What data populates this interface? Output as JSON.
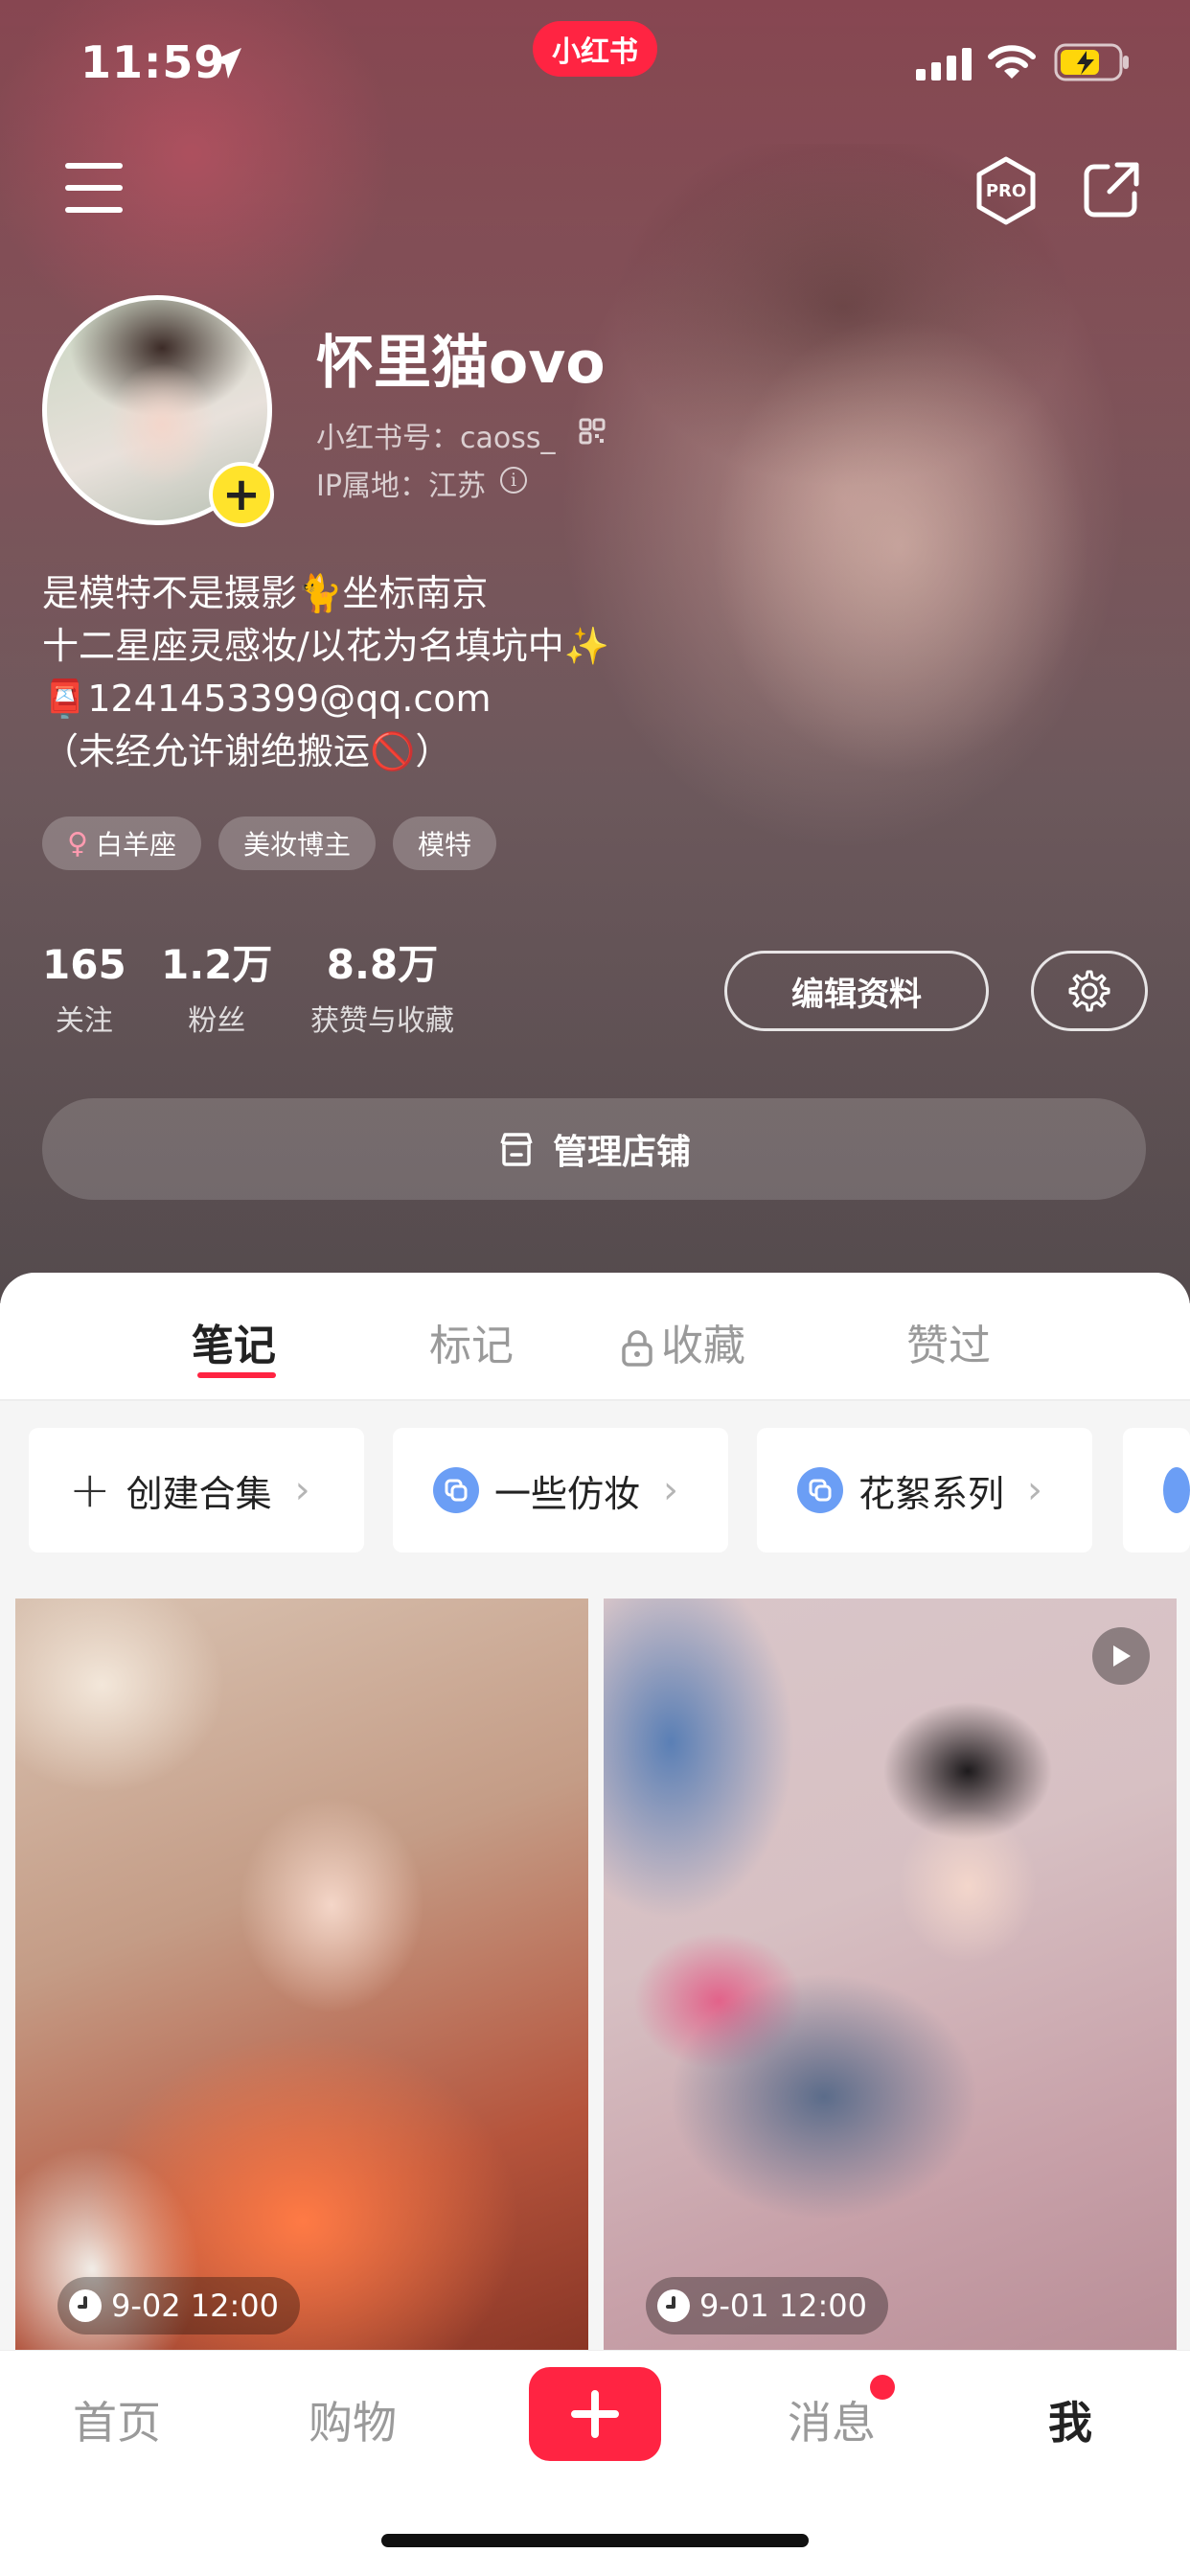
{
  "status_bar": {
    "time": "11:59",
    "app_badge": "小红书"
  },
  "profile": {
    "nickname": "怀里猫ovo",
    "rednote_id": "小红书号：caoss_",
    "ip_location": "IP属地：江苏",
    "bio": [
      "是模特不是摄影🐈坐标南京",
      "十二星座灵感妆/以花为名填坑中✨",
      "📮1241453399@qq.com",
      "（未经允许谢绝搬运🚫）"
    ],
    "tags": [
      "白羊座",
      "美妆博主",
      "模特"
    ]
  },
  "stats": [
    {
      "value": "165",
      "label": "关注"
    },
    {
      "value": "1.2万",
      "label": "粉丝"
    },
    {
      "value": "8.8万",
      "label": "获赞与收藏"
    }
  ],
  "actions": {
    "edit_profile": "编辑资料",
    "manage_store": "管理店铺"
  },
  "tabs": [
    "笔记",
    "标记",
    "收藏",
    "赞过"
  ],
  "collections": [
    "创建合集",
    "一些仿妆",
    "花絮系列"
  ],
  "notes": [
    {
      "time": "9-02 12:00"
    },
    {
      "time": "9-01 12:00"
    }
  ],
  "bottom_nav": [
    "首页",
    "购物",
    "消息",
    "我"
  ],
  "colors": {
    "accent": "#ff2442",
    "tag_yellow": "#ffe32b",
    "collection_icon": "#6b9ef5"
  },
  "icons": {
    "location_arrow": "location-arrow-icon",
    "menu": "menu-icon",
    "pro": "pro-icon",
    "share": "share-icon",
    "qr": "qr-code-icon",
    "info": "info-icon",
    "settings": "gear-icon",
    "store": "store-icon",
    "lock": "lock-icon",
    "video": "play-icon",
    "clock": "clock-icon"
  }
}
